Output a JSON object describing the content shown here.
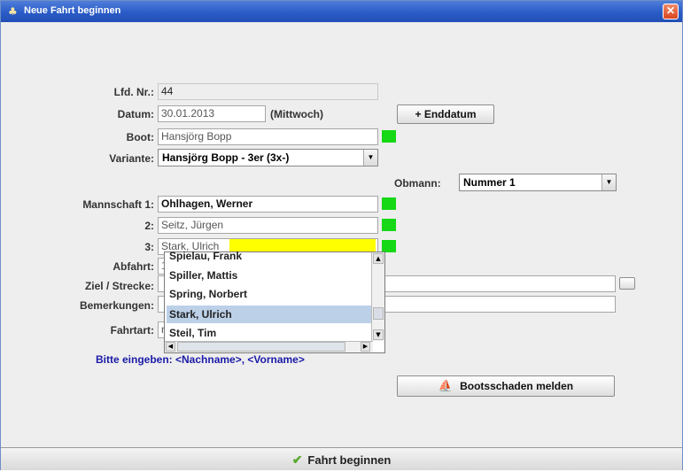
{
  "window": {
    "title": "Neue Fahrt beginnen",
    "close_glyph": "✕",
    "title_icon_glyph": "♣"
  },
  "form": {
    "lfd_nr": {
      "label": "Lfd. Nr.:",
      "value": "44"
    },
    "datum": {
      "label": "Datum:",
      "value": "30.01.2013",
      "weekday": "(Mittwoch)"
    },
    "enddatum_button": "+ Enddatum",
    "boot": {
      "label": "Boot:",
      "value": "Hansjörg Bopp"
    },
    "variante": {
      "label": "Variante:",
      "value": "Hansjörg Bopp - 3er (3x-)"
    },
    "obmann": {
      "label": "Obmann:",
      "value": "Nummer 1"
    },
    "mannschaft_1": {
      "label": "Mannschaft 1:",
      "value": "Ohlhagen, Werner"
    },
    "mannschaft_2": {
      "label": "2:",
      "value": "Seitz, Jürgen"
    },
    "mannschaft_3": {
      "label": "3:",
      "value_typed": "Stark, Ulrich"
    },
    "abfahrt": {
      "label": "Abfahrt:",
      "value": "1"
    },
    "ziel": {
      "label": "Ziel / Strecke:",
      "value": ""
    },
    "bemerkungen": {
      "label": "Bemerkungen:",
      "value": ""
    },
    "fahrtart": {
      "label": "Fahrtart:",
      "value": "n"
    }
  },
  "autocomplete": {
    "items": [
      "Spielau, Frank",
      "Spiller, Mattis",
      "Spring, Norbert",
      "Stark, Ulrich",
      "Steil, Tim"
    ],
    "selected_index": 3
  },
  "hint": "Bitte eingeben: <Nachname>, <Vorname>",
  "bootsschaden_button": "Bootsschaden melden",
  "start_button": "Fahrt beginnen",
  "colors": {
    "ok_indicator": "#16d816",
    "highlight": "#ffff00",
    "selection": "#bcd0e8",
    "hint_text": "#1a1aa8"
  }
}
